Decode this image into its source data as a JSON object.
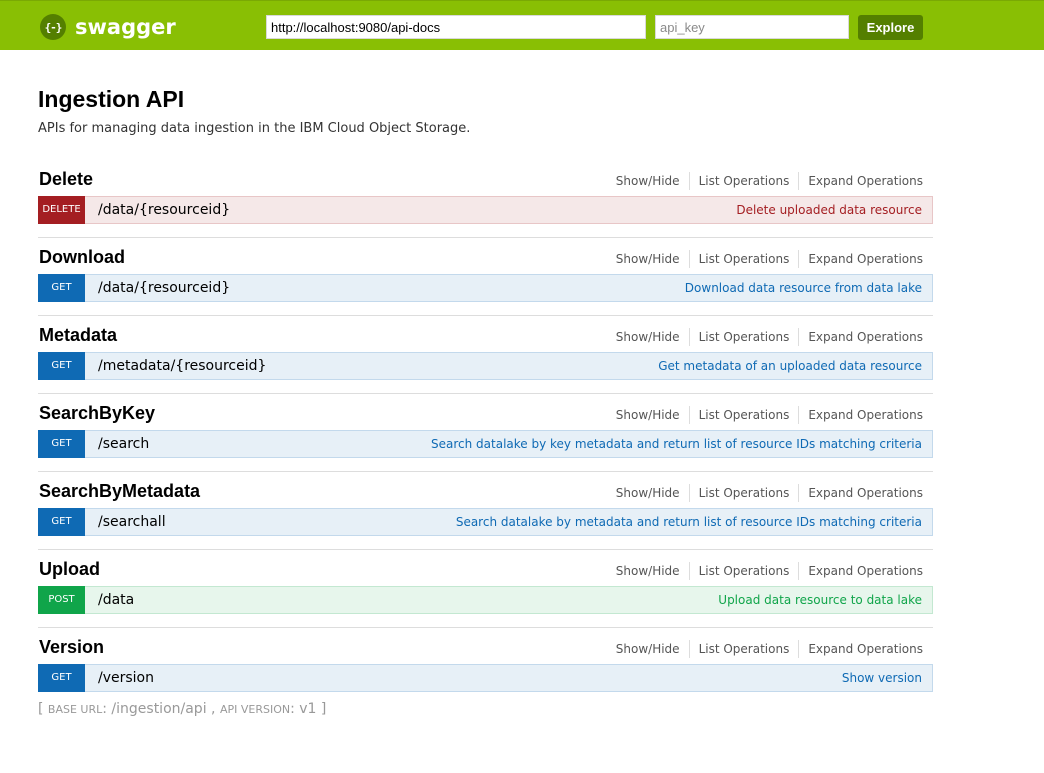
{
  "header": {
    "logo_symbol": "{-}",
    "logo_text": "swagger",
    "url_value": "http://localhost:9080/api-docs",
    "api_key_placeholder": "api_key",
    "explore_label": "Explore",
    "bg_color": "#89bf04"
  },
  "info": {
    "title": "Ingestion API",
    "description": "APIs for managing data ingestion in the IBM Cloud Object Storage."
  },
  "resource_links": {
    "show_hide": "Show/Hide",
    "list_operations": "List Operations",
    "expand_operations": "Expand Operations"
  },
  "resources": [
    {
      "name": "Delete",
      "method": "DELETE",
      "method_class": "delete",
      "path": "/data/{resourceid}",
      "summary": "Delete uploaded data resource"
    },
    {
      "name": "Download",
      "method": "GET",
      "method_class": "get",
      "path": "/data/{resourceid}",
      "summary": "Download data resource from data lake"
    },
    {
      "name": "Metadata",
      "method": "GET",
      "method_class": "get",
      "path": "/metadata/{resourceid}",
      "summary": "Get metadata of an uploaded data resource"
    },
    {
      "name": "SearchByKey",
      "method": "GET",
      "method_class": "get",
      "path": "/search",
      "summary": "Search datalake by key metadata and return list of resource IDs matching criteria"
    },
    {
      "name": "SearchByMetadata",
      "method": "GET",
      "method_class": "get",
      "path": "/searchall",
      "summary": "Search datalake by metadata and return list of resource IDs matching criteria"
    },
    {
      "name": "Upload",
      "method": "POST",
      "method_class": "post",
      "path": "/data",
      "summary": "Upload data resource to data lake"
    },
    {
      "name": "Version",
      "method": "GET",
      "method_class": "get",
      "path": "/version",
      "summary": "Show version"
    }
  ],
  "footer": {
    "open_bracket": "[",
    "base_url_label": "base url",
    "base_url_value": "/ingestion/api",
    "api_version_label": "api version",
    "api_version_value": "v1",
    "close_bracket": "]"
  },
  "colors": {
    "get": "#0f6ab4",
    "delete": "#a41e22",
    "post": "#10a54a"
  }
}
